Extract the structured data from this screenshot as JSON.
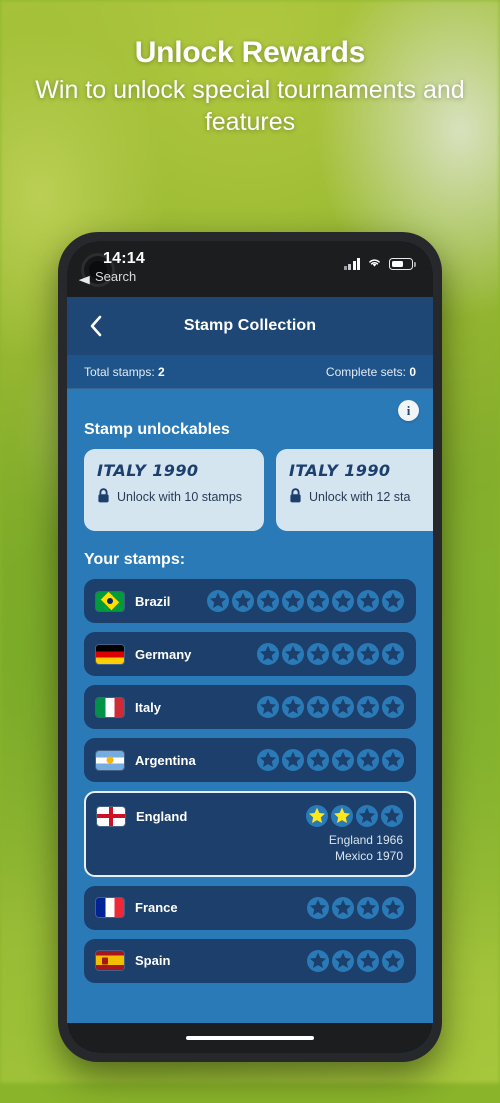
{
  "promo": {
    "headline": "Unlock Rewards",
    "subline": "Win to unlock special tournaments and features"
  },
  "status_bar": {
    "time": "14:14",
    "back_label": "Search",
    "signal_icon": "cellular-signal-icon",
    "wifi_icon": "wifi-icon",
    "battery_icon": "battery-icon"
  },
  "header": {
    "back_icon": "chevron-left-icon",
    "title": "Stamp Collection"
  },
  "stats": {
    "total_label": "Total stamps:",
    "total_value": "2",
    "sets_label": "Complete sets:",
    "sets_value": "0"
  },
  "unlockables": {
    "section_title": "Stamp unlockables",
    "info_icon": "info-icon",
    "info_glyph": "i",
    "cards": [
      {
        "title": "ITALY 1990",
        "requirement": "Unlock with 10 stamps",
        "lock_icon": "lock-icon"
      },
      {
        "title": "ITALY 1990",
        "requirement": "Unlock with 12 sta",
        "lock_icon": "lock-icon"
      }
    ]
  },
  "stamps": {
    "section_title": "Your stamps:",
    "rows": [
      {
        "country": "Brazil",
        "flag": "flag-brazil",
        "stars_total": 8,
        "stars_filled": 0,
        "won": []
      },
      {
        "country": "Germany",
        "flag": "flag-germany",
        "stars_total": 6,
        "stars_filled": 0,
        "won": []
      },
      {
        "country": "Italy",
        "flag": "flag-italy",
        "stars_total": 6,
        "stars_filled": 0,
        "won": []
      },
      {
        "country": "Argentina",
        "flag": "flag-argentina",
        "stars_total": 6,
        "stars_filled": 0,
        "won": []
      },
      {
        "country": "England",
        "flag": "flag-england",
        "stars_total": 4,
        "stars_filled": 2,
        "highlighted": true,
        "won": [
          "England 1966",
          "Mexico 1970"
        ]
      },
      {
        "country": "France",
        "flag": "flag-france",
        "stars_total": 4,
        "stars_filled": 0,
        "won": []
      },
      {
        "country": "Spain",
        "flag": "flag-spain",
        "stars_total": 4,
        "stars_filled": 0,
        "won": []
      }
    ]
  },
  "colors": {
    "app_background": "#2a7ab8",
    "header": "#1e4775",
    "stats_bar": "#1e5489",
    "row_card": "#1c3f6b",
    "unlock_card": "#d4e5f0",
    "star_filled": "#ffe81a",
    "star_empty": "#1c3f6b",
    "text_primary": "#ffffff"
  },
  "home_indicator": "home-indicator"
}
